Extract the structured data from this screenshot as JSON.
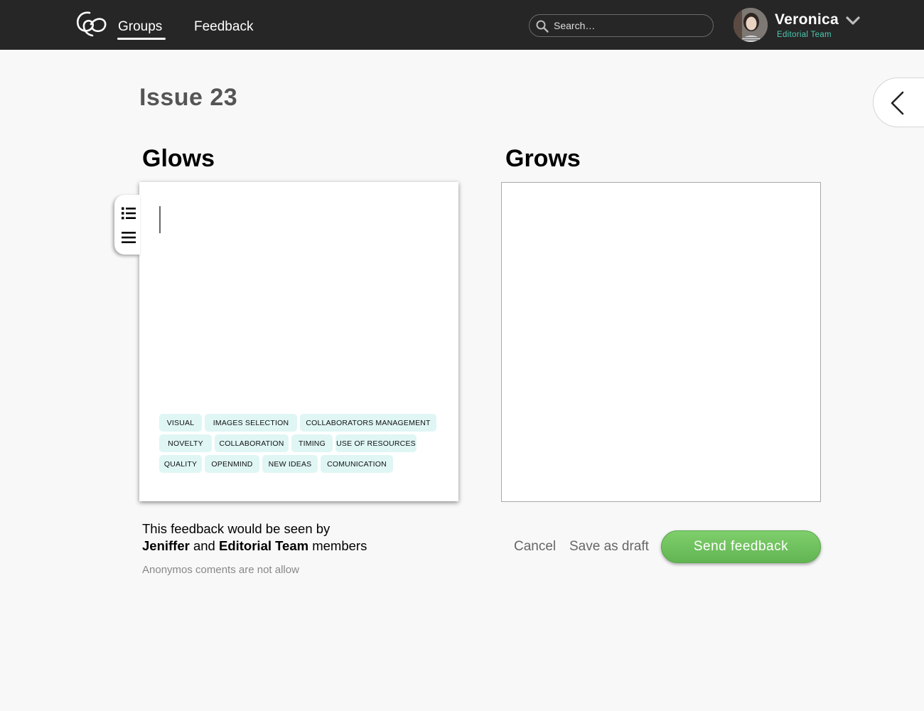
{
  "header": {
    "nav": [
      {
        "label": "Groups",
        "active": true
      },
      {
        "label": "Feedback",
        "active": false
      }
    ],
    "search": {
      "placeholder": "Search…",
      "value": ""
    },
    "user": {
      "name": "Veronica",
      "team": "Editorial Team"
    }
  },
  "page": {
    "title": "Issue 23",
    "glows": {
      "title": "Glows",
      "tag_rows": [
        [
          "VISUAL",
          "IMAGES SELECTION",
          "COLLABORATORS MANAGEMENT"
        ],
        [
          "NOVELTY",
          "COLLABORATION",
          "TIMING",
          "USE OF RESOURCES"
        ],
        [
          "QUALITY",
          "OPENMIND",
          "NEW IDEAS",
          "COMUNICATION"
        ]
      ]
    },
    "grows": {
      "title": "Grows"
    },
    "visibility": {
      "line1": "This feedback would be seen by",
      "person": "Jeniffer",
      "and": "and",
      "group": "Editorial Team",
      "suffix": "members"
    },
    "anonymous_note": "Anonymos coments are not allow",
    "actions": {
      "cancel": "Cancel",
      "draft": "Save as draft",
      "send": "Send feedback"
    }
  },
  "colors": {
    "topbar": "#262626",
    "accent_team": "#4ec9b0",
    "tag_bg": "#dff6f4",
    "send_button": "#6cc15b"
  },
  "icons": [
    "logo-icon",
    "search-icon",
    "chevron-down-icon",
    "chevron-left-icon",
    "list-icon",
    "align-justify-icon"
  ]
}
